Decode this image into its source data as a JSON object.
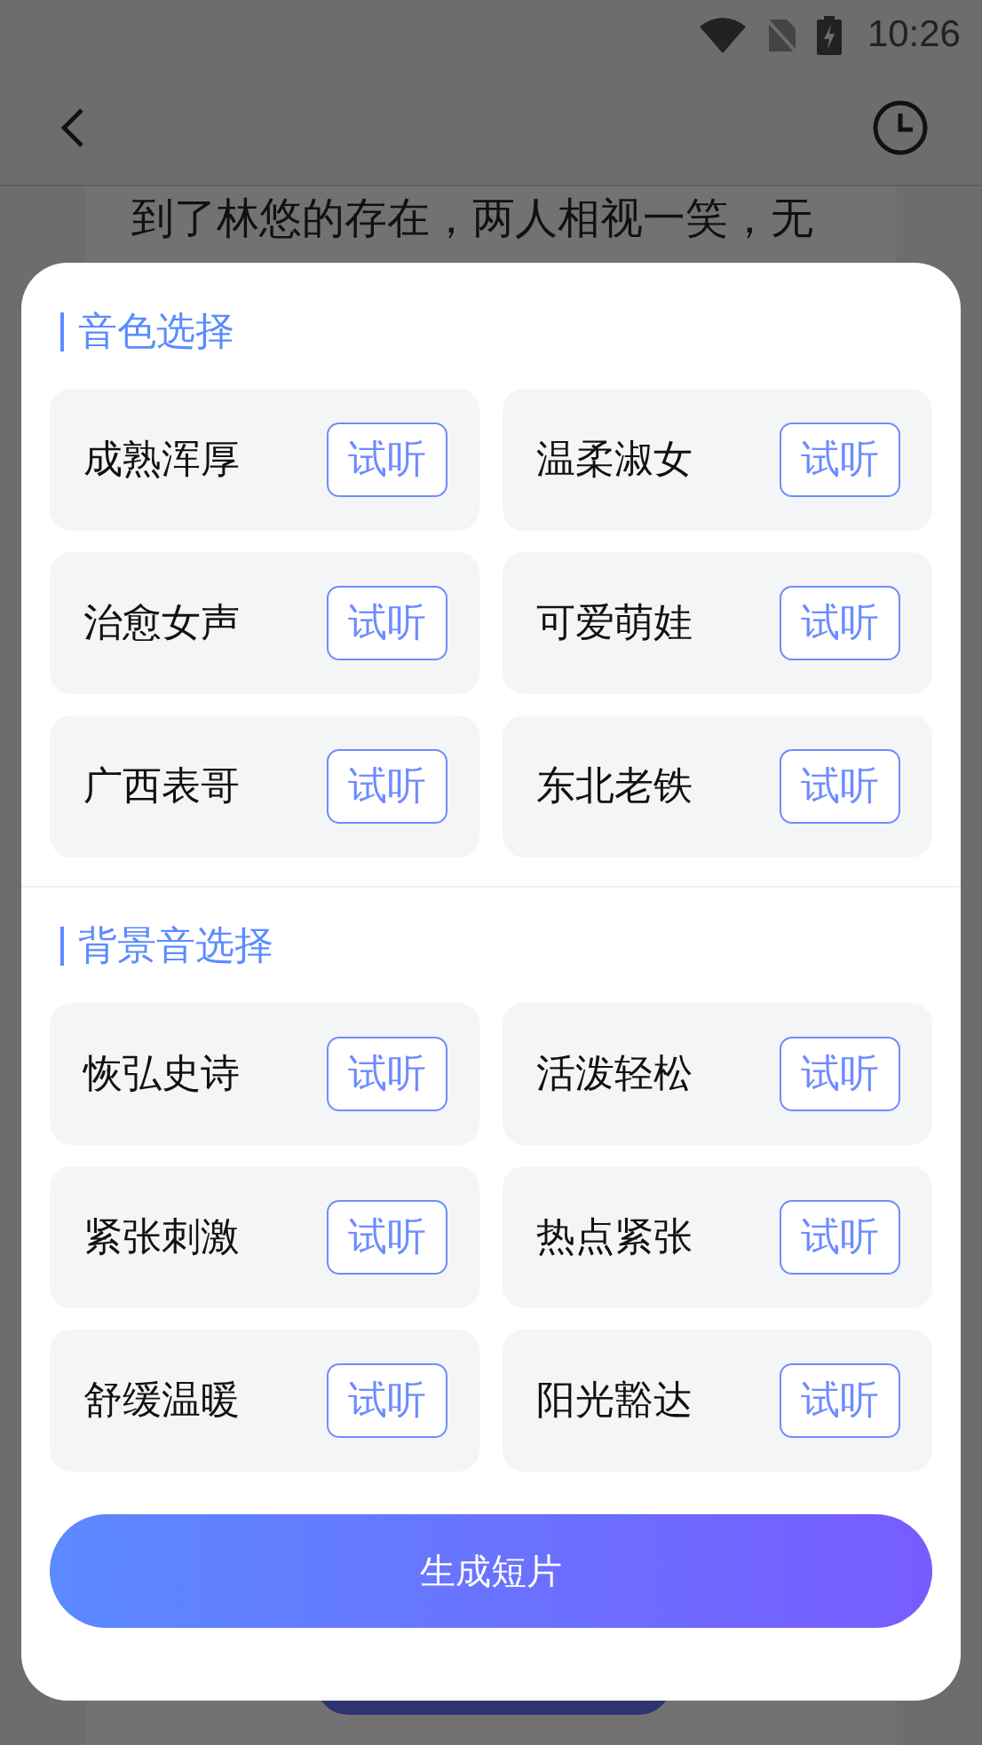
{
  "status_bar": {
    "time": "10:26"
  },
  "background_text": "到了林悠的存在，两人相视一笑，无",
  "sections": [
    {
      "title": "音色选择",
      "items": [
        {
          "name": "成熟浑厚",
          "action": "试听"
        },
        {
          "name": "温柔淑女",
          "action": "试听"
        },
        {
          "name": "治愈女声",
          "action": "试听"
        },
        {
          "name": "可爱萌娃",
          "action": "试听"
        },
        {
          "name": "广西表哥",
          "action": "试听"
        },
        {
          "name": "东北老铁",
          "action": "试听"
        }
      ]
    },
    {
      "title": "背景音选择",
      "items": [
        {
          "name": "恢弘史诗",
          "action": "试听"
        },
        {
          "name": "活泼轻松",
          "action": "试听"
        },
        {
          "name": "紧张刺激",
          "action": "试听"
        },
        {
          "name": "热点紧张",
          "action": "试听"
        },
        {
          "name": "舒缓温暖",
          "action": "试听"
        },
        {
          "name": "阳光豁达",
          "action": "试听"
        }
      ]
    }
  ],
  "primary_button": "生成短片"
}
